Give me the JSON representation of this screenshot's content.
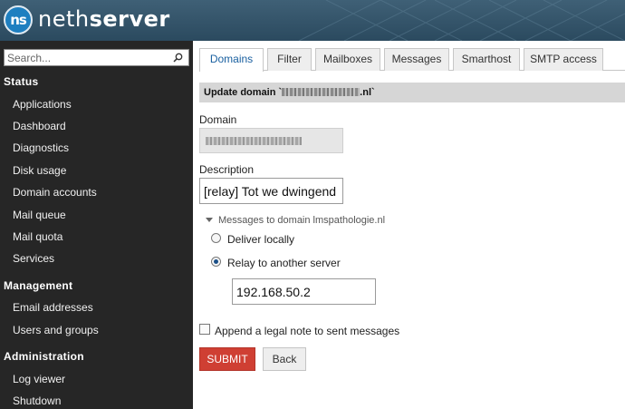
{
  "brand": {
    "logo_mark": "ns",
    "name_light": "neth",
    "name_bold": "server"
  },
  "search": {
    "placeholder": "Search...",
    "icon": "search-icon"
  },
  "sidebar": {
    "sections": [
      {
        "title": "Status",
        "items": [
          "Applications",
          "Dashboard",
          "Diagnostics",
          "Disk usage",
          "Domain accounts",
          "Mail queue",
          "Mail quota",
          "Services"
        ]
      },
      {
        "title": "Management",
        "items": [
          "Email addresses",
          "Users and groups"
        ]
      },
      {
        "title": "Administration",
        "items": [
          "Log viewer",
          "Shutdown"
        ]
      }
    ]
  },
  "tabs": [
    "Domains",
    "Filter",
    "Mailboxes",
    "Messages",
    "Smarthost",
    "SMTP access"
  ],
  "active_tab": "Domains",
  "form": {
    "title_prefix": "Update domain `",
    "title_suffix": ".nl`",
    "domain_label": "Domain",
    "description_label": "Description",
    "description_value": "[relay] Tot we dwingend",
    "messages_toggle": "Messages to domain lmspathologie.nl",
    "deliver_locally": "Deliver locally",
    "relay_option": "Relay to another server",
    "relay_selected": true,
    "relay_host": "192.168.50.2",
    "legal_note": "Append a legal note to sent messages",
    "legal_note_checked": false,
    "submit": "SUBMIT",
    "back": "Back"
  },
  "colors": {
    "header": "#2b4a5f",
    "sidebar": "#262626",
    "submit": "#cf3f33",
    "active_tab_text": "#1a60a0"
  }
}
